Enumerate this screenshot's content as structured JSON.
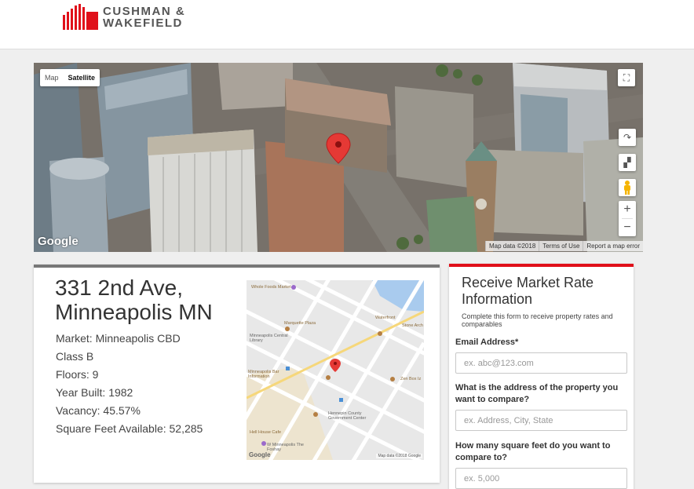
{
  "brand": {
    "line1": "CUSHMAN &",
    "line2": "WAKEFIELD",
    "color": "#e0101a"
  },
  "aerial_map": {
    "map_type": {
      "map_label": "Map",
      "satellite_label": "Satellite",
      "selected": "Satellite"
    },
    "watermark": "Google",
    "attribution": {
      "map_data": "Map data ©2018",
      "terms": "Terms of Use",
      "report": "Report a map error"
    },
    "controls": [
      "fullscreen-icon",
      "rotate-icon",
      "tilt-icon",
      "pegman-icon"
    ],
    "zoom_in": "+",
    "zoom_out": "−"
  },
  "property": {
    "title_line1": "331 2nd Ave,",
    "title_line2": "Minneapolis MN",
    "market": "Market: Minneapolis CBD",
    "class": "Class B",
    "floors": "Floors: 9",
    "year_built": "Year Built: 1982",
    "vacancy": "Vacancy: 45.57%",
    "sqft_available": "Square Feet Available: 52,285"
  },
  "mini_map": {
    "labels": {
      "whole_foods": "Whole Foods Market",
      "waterfront": "Waterfront",
      "marquette": "Marquette Plaza",
      "stone_arch": "Stone Arch",
      "central_library": "Minneapolis Central Library",
      "info": "Minneapolis Bar Information",
      "zen_box": "Zen Box Iz",
      "hennepin": "Hennepin County Government Center",
      "hell_house": "Hell House Cafe",
      "w_minneapolis": "W Minneapolis The Foshay"
    },
    "watermark": "Google",
    "attribution": "Map data ©2018 Google"
  },
  "form": {
    "title_line1": "Receive Market Rate",
    "title_line2": "Information",
    "subtitle": "Complete this form to receive property rates and comparables",
    "email_label": "Email Address*",
    "email_placeholder": "ex. abc@123.com",
    "address_label": "What is the address of the property you want to compare?",
    "address_placeholder": "ex. Address, City, State",
    "sqft_label": "How many square feet do you want to compare to?",
    "sqft_placeholder": "ex. 5,000"
  },
  "colors": {
    "accent_red": "#e0101a",
    "card_top": "#777777",
    "pin": "#e53935"
  }
}
